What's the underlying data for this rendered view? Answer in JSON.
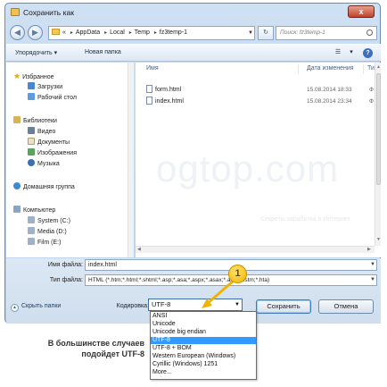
{
  "window": {
    "title": "Сохранить как",
    "close": "x"
  },
  "address": {
    "prefix": "«",
    "crumbs": [
      "AppData",
      "Local",
      "Temp",
      "fz3temp-1"
    ],
    "search_placeholder": "Поиск: fz3temp-1"
  },
  "toolbar": {
    "organize": "Упорядочить ▾",
    "new_folder": "Новая папка"
  },
  "sidebar": {
    "favorites": {
      "label": "Избранное",
      "items": [
        "Загрузки",
        "Рабочий стол"
      ]
    },
    "libraries": {
      "label": "Библиотеки",
      "items": [
        "Видео",
        "Документы",
        "Изображения",
        "Музыка"
      ]
    },
    "homegroup": "Домашняя группа",
    "computer": {
      "label": "Компьютер",
      "items": [
        "System (C:)",
        "Media (D:)",
        "Film (E:)"
      ]
    }
  },
  "filelist": {
    "headers": {
      "name": "Имя",
      "date": "Дата изменения",
      "type": "Тип"
    },
    "rows": [
      {
        "name": "form.html",
        "date": "15.08.2014 18:33",
        "type": "Ф"
      },
      {
        "name": "index.html",
        "date": "15.08.2014 23:34",
        "type": "Ф"
      }
    ]
  },
  "watermark": {
    "main": "ogtop.com",
    "sub": "Секреты заработка в Интернет"
  },
  "form": {
    "filename_label": "Имя файла:",
    "filename_value": "index.html",
    "filetype_label": "Тип файла:",
    "filetype_value": "HTML (*.htm;*.html;*.shtml;*.asp;*.asa;*.aspx;*.asax;*.ascx;*.stm;*.hta)",
    "encoding_label": "Кодировка:",
    "encoding_value": "UTF-8",
    "save": "Сохранить",
    "cancel": "Отмена",
    "hide_folders": "Скрыть папки"
  },
  "encoding_options": [
    "ANSI",
    "Unicode",
    "Unicode big endian",
    "UTF-8",
    "UTF-8 + BOM",
    "Western European (Windows)",
    "Cyrillic (Windows) 1251",
    "More..."
  ],
  "encoding_selected_index": 3,
  "callout": {
    "number": "1",
    "color": "#f4c200"
  },
  "caption": "В большинстве случаев подойдет UTF-8"
}
